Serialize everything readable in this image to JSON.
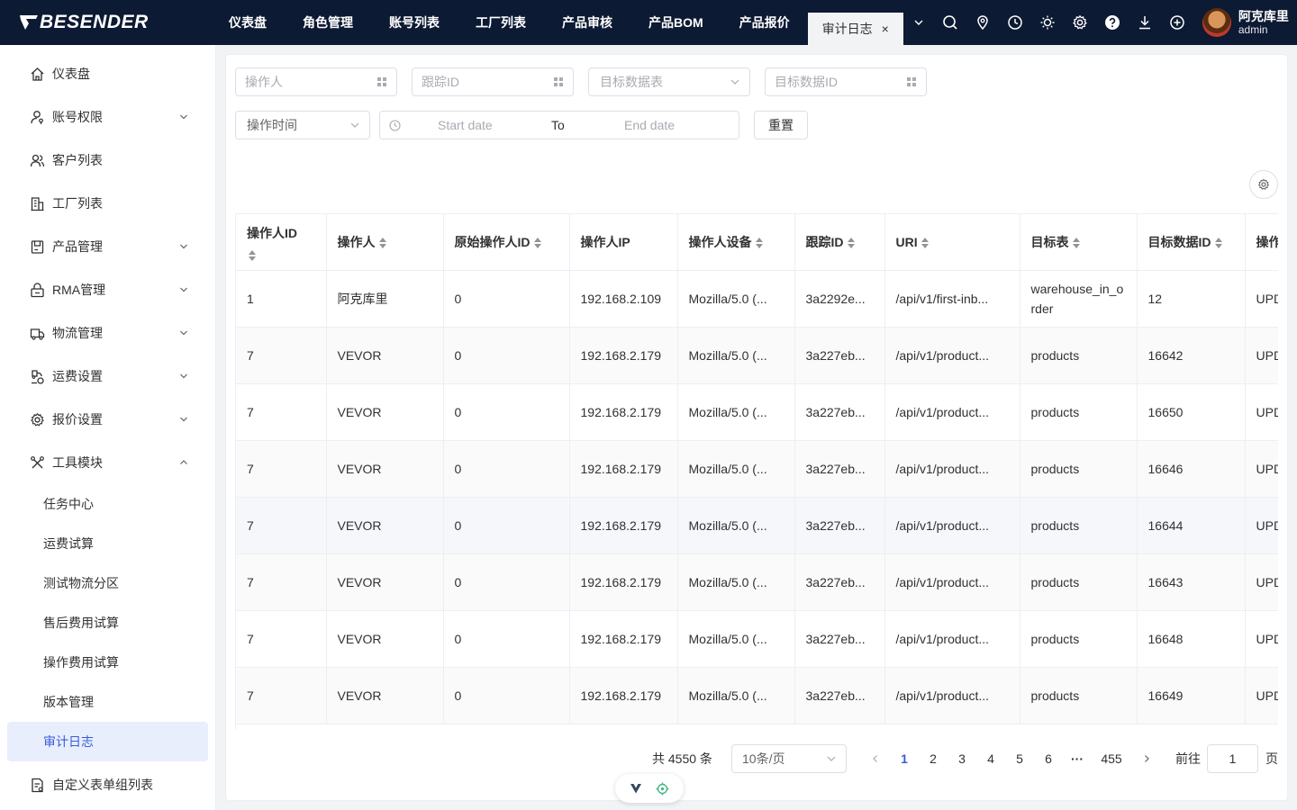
{
  "brand": {
    "name": "BESENDER"
  },
  "nav": {
    "tabs": [
      {
        "label": "仪表盘"
      },
      {
        "label": "角色管理"
      },
      {
        "label": "账号列表"
      },
      {
        "label": "工厂列表"
      },
      {
        "label": "产品审核"
      },
      {
        "label": "产品BOM"
      },
      {
        "label": "产品报价"
      }
    ],
    "active_tab": {
      "label": "审计日志",
      "close": "×"
    }
  },
  "user": {
    "name": "阿克库里",
    "role": "admin"
  },
  "sidebar": {
    "items": [
      {
        "label": "仪表盘",
        "icon": "home-icon"
      },
      {
        "label": "账号权限",
        "icon": "user-key-icon"
      },
      {
        "label": "客户列表",
        "icon": "users-icon"
      },
      {
        "label": "工厂列表",
        "icon": "building-icon"
      },
      {
        "label": "产品管理",
        "icon": "box-icon"
      },
      {
        "label": "RMA管理",
        "icon": "rma-icon"
      },
      {
        "label": "物流管理",
        "icon": "truck-icon"
      },
      {
        "label": "运费设置",
        "icon": "freight-icon"
      },
      {
        "label": "报价设置",
        "icon": "gear-icon"
      },
      {
        "label": "工具模块",
        "icon": "tools-icon"
      }
    ],
    "sub_items": [
      {
        "label": "任务中心"
      },
      {
        "label": "运费试算"
      },
      {
        "label": "测试物流分区"
      },
      {
        "label": "售后费用试算"
      },
      {
        "label": "操作费用试算"
      },
      {
        "label": "版本管理"
      },
      {
        "label": "审计日志"
      }
    ],
    "last_item": {
      "label": "自定义表单组列表",
      "icon": "form-list-icon"
    }
  },
  "filters": {
    "operator": {
      "placeholder": "操作人"
    },
    "trace_id": {
      "placeholder": "跟踪ID"
    },
    "target_table": {
      "placeholder": "目标数据表"
    },
    "target_data_id": {
      "placeholder": "目标数据ID"
    },
    "time_type": {
      "value": "操作时间"
    },
    "start_date": {
      "placeholder": "Start date"
    },
    "range_separator": "To",
    "end_date": {
      "placeholder": "End date"
    },
    "reset_label": "重置"
  },
  "table": {
    "columns": [
      "操作人ID",
      "操作人",
      "原始操作人ID",
      "操作人IP",
      "操作人设备",
      "跟踪ID",
      "URI",
      "目标表",
      "目标数据ID",
      "操作"
    ],
    "rows": [
      [
        "1",
        "阿克库里",
        "0",
        "192.168.2.109",
        "Mozilla/5.0 (...",
        "3a2292e...",
        "/api/v1/first-inb...",
        "warehouse_in_order",
        "12",
        "UPD"
      ],
      [
        "7",
        "VEVOR",
        "0",
        "192.168.2.179",
        "Mozilla/5.0 (...",
        "3a227eb...",
        "/api/v1/product...",
        "products",
        "16642",
        "UPD"
      ],
      [
        "7",
        "VEVOR",
        "0",
        "192.168.2.179",
        "Mozilla/5.0 (...",
        "3a227eb...",
        "/api/v1/product...",
        "products",
        "16650",
        "UPD"
      ],
      [
        "7",
        "VEVOR",
        "0",
        "192.168.2.179",
        "Mozilla/5.0 (...",
        "3a227eb...",
        "/api/v1/product...",
        "products",
        "16646",
        "UPD"
      ],
      [
        "7",
        "VEVOR",
        "0",
        "192.168.2.179",
        "Mozilla/5.0 (...",
        "3a227eb...",
        "/api/v1/product...",
        "products",
        "16644",
        "UPD"
      ],
      [
        "7",
        "VEVOR",
        "0",
        "192.168.2.179",
        "Mozilla/5.0 (...",
        "3a227eb...",
        "/api/v1/product...",
        "products",
        "16643",
        "UPD"
      ],
      [
        "7",
        "VEVOR",
        "0",
        "192.168.2.179",
        "Mozilla/5.0 (...",
        "3a227eb...",
        "/api/v1/product...",
        "products",
        "16648",
        "UPD"
      ],
      [
        "7",
        "VEVOR",
        "0",
        "192.168.2.179",
        "Mozilla/5.0 (...",
        "3a227eb...",
        "/api/v1/product...",
        "products",
        "16649",
        "UPD"
      ]
    ]
  },
  "pagination": {
    "total": "共 4550 条",
    "page_size": "10条/页",
    "pages": [
      "1",
      "2",
      "3",
      "4",
      "5",
      "6"
    ],
    "ellipsis": "···",
    "last_page": "455",
    "goto_prefix": "前往",
    "goto_value": "1",
    "goto_suffix": "页"
  },
  "colors": {
    "topbar": "#0c1a33",
    "accent": "#3b5bdb",
    "active_bg": "#e8eefc"
  }
}
